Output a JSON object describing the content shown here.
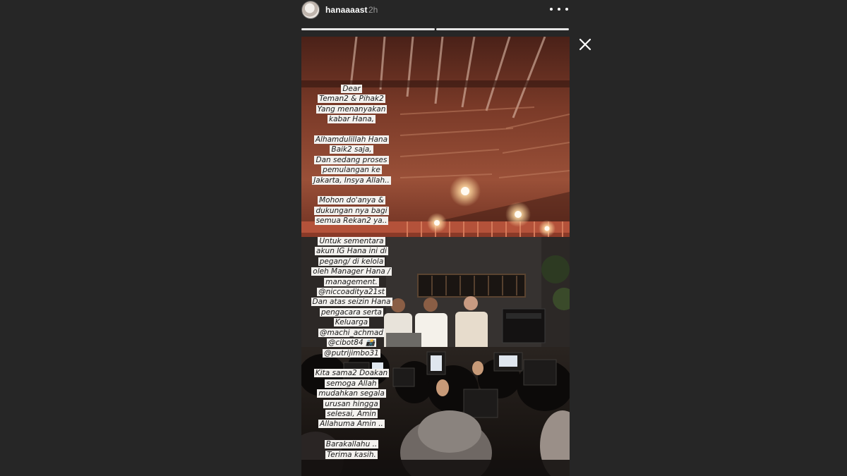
{
  "header": {
    "username": "hanaaaast",
    "time_ago": "2h",
    "avatar_icon": "profile-avatar",
    "more_icon": "more-options-icon"
  },
  "progress": {
    "segments": 2,
    "current_segment": 1,
    "fill_fraction": 1.0
  },
  "close_icon": "close-icon",
  "story": {
    "paragraphs": [
      [
        "Dear",
        "Teman2 & Pihak2",
        "Yang menanyakan",
        "kabar Hana,"
      ],
      [
        "Alhamdulillah Hana",
        "Baik2 saja,",
        "Dan sedang proses",
        "pemulangan ke",
        "Jakarta, Insya Allah.."
      ],
      [
        "Mohon do'anya &",
        "dukungan nya bagi",
        "semua Rekan2 ya.."
      ],
      [
        "Untuk sementara",
        "akun IG Hana ini di",
        "pegang/ di kelola",
        "oleh Manager Hana /",
        "management.",
        "@niccoaditya21st",
        "Dan atas seizin Hana",
        "pengacara serta",
        "Keluarga",
        "@machi_achmad",
        "@cibot84 📸",
        "@putrijimbo31"
      ],
      [
        "Kita sama2 Doakan",
        "semoga Allah",
        "mudahkan segala",
        "urusan hingga",
        "selesai, Amin",
        "Allahuma Amin .."
      ],
      [
        "Barakallahu ..",
        "Terima kasih."
      ]
    ]
  },
  "colors": {
    "background": "#262626",
    "text_highlight": "#f3f1ee"
  }
}
